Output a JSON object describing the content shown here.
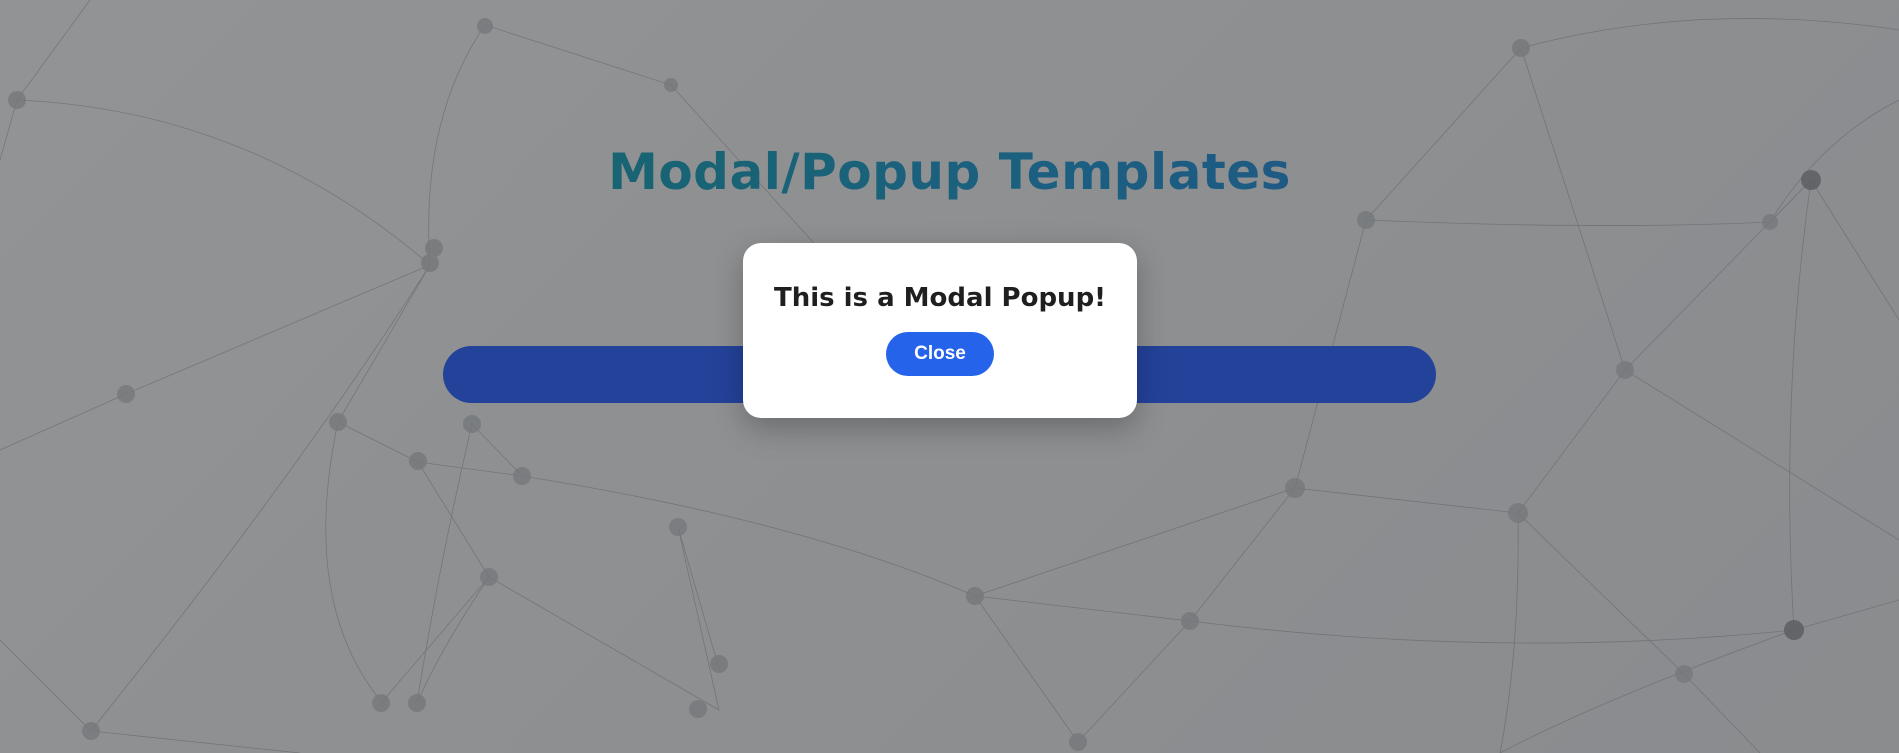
{
  "header": {
    "title": "Modal/Popup Templates"
  },
  "background": {
    "pattern": "network-nodes-icon"
  },
  "modal": {
    "title": "This is a Modal Popup!",
    "close_label": "Close"
  },
  "colors": {
    "title_gradient_start": "#1fb39a",
    "title_gradient_end": "#3a82e6",
    "primary_bar": "#3b6fff",
    "close_button": "#2563eb",
    "overlay": "rgba(0,0,0,0.4)"
  }
}
